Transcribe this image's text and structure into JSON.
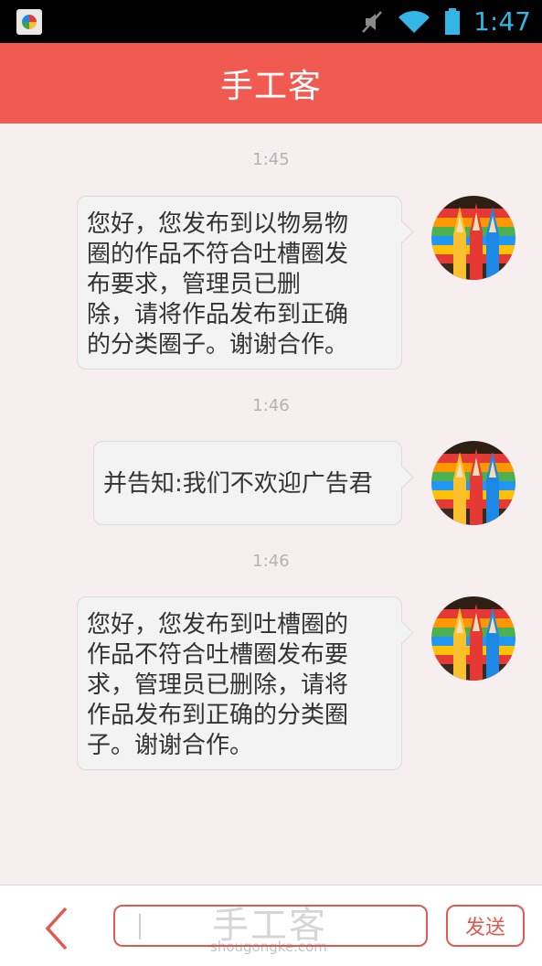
{
  "status_bar": {
    "time": "1:47"
  },
  "header": {
    "title": "手工客"
  },
  "messages": [
    {
      "timestamp": "1:45",
      "lines": [
        "您好，您发布到以物易物",
        "圈的作品不符合吐槽圈发",
        "布要求，管理员已删",
        "除，请将作品发布到正确",
        "的分类圈子。谢谢合作。"
      ]
    },
    {
      "timestamp": "1:46",
      "lines": [
        "并告知:我们不欢迎广告君"
      ]
    },
    {
      "timestamp": "1:46",
      "lines": [
        "您好，您发布到吐槽圈的",
        "作品不符合吐槽圈发布要",
        "求，管理员已删除，请将",
        "作品发布到正确的分类圈",
        "子。谢谢合作。"
      ]
    }
  ],
  "input_bar": {
    "placeholder": "",
    "send_label": "发送"
  },
  "watermark": {
    "cn": "手工客",
    "en": "shougongke.com"
  },
  "colors": {
    "accent": "#f05a50",
    "background": "#f7eef0",
    "bubble": "#f3f3f3",
    "timestamp": "#b3b3b3"
  }
}
